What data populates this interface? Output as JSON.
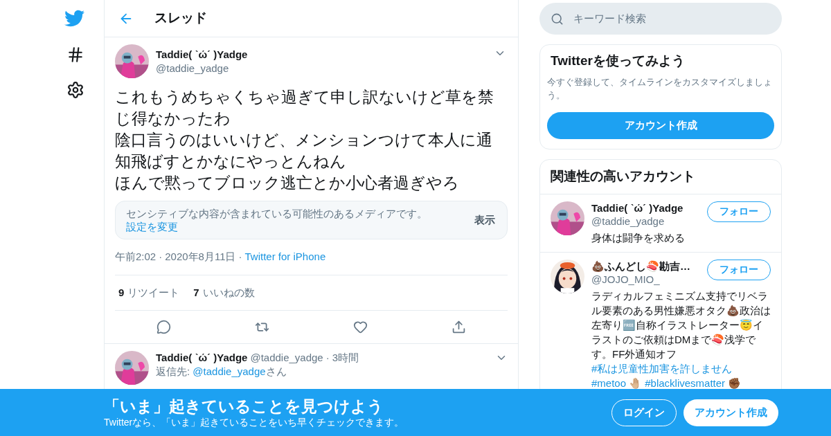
{
  "header": {
    "title": "スレッド"
  },
  "search": {
    "placeholder": "キーワード検索"
  },
  "tweet": {
    "name": "Taddie( ˋώˊ )Yadge",
    "handle": "@taddie_yadge",
    "paragraphs": [
      "これもうめちゃくちゃ過ぎて申し訳ないけど草を禁じ得なかったわ",
      "陰口言うのはいいけど、メンションつけて本人に通知飛ばすとかなにやっとんねん",
      "ほんで黙ってブロック逃亡とか小心者過ぎやろ"
    ],
    "sensitive": {
      "text": "センシティブな内容が含まれている可能性のあるメディアです。",
      "link": "設定を変更",
      "button": "表示"
    },
    "time": "午前2:02",
    "date": "2020年8月11日",
    "source": "Twitter for iPhone",
    "separator": "·",
    "stats": [
      {
        "count": "9",
        "label": "リツイート"
      },
      {
        "count": "7",
        "label": "いいねの数"
      }
    ]
  },
  "reply": {
    "name": "Taddie( ˋώˊ )Yadge",
    "handle": "@taddie_yadge",
    "separator": "·",
    "time": "3時間",
    "reply_prefix": "返信先: ",
    "reply_to": "@taddie_yadge",
    "reply_suffix": "さん"
  },
  "signup_card": {
    "title": "Twitterを使ってみよう",
    "description": "今すぐ登録して、タイムラインをカスタマイズしましょう。",
    "button": "アカウント作成"
  },
  "related": {
    "title": "関連性の高いアカウント",
    "accounts": [
      {
        "name": "Taddie( ˋώˊ )Yadge",
        "handle": "@taddie_yadge",
        "button": "フォロー",
        "bio": [
          {
            "kind": "plain",
            "text": "身体は闘争を求める"
          }
        ]
      },
      {
        "name": "💩ふんどし🍣勘吉…",
        "handle": "@JOJO_MIO_",
        "button": "フォロー",
        "bio": [
          {
            "kind": "plain",
            "text": "ラディカルフェミニズム支持でリベラル要素のある男性嫌悪オタク💩政治は左寄り🆓自称イラストレーター😇イラストのご依頼はDMまで🍣浅学です。FF外通知オフ "
          },
          {
            "kind": "link",
            "text": "#私は児童性加害を許しません"
          },
          {
            "kind": "link",
            "text": "#metoo"
          },
          {
            "kind": "plain",
            "text": "🤚🏼 "
          },
          {
            "kind": "link",
            "text": "#blacklivesmatter"
          },
          {
            "kind": "plain",
            "text": "✊🏾"
          }
        ]
      }
    ]
  },
  "banner": {
    "title": "「いま」起きていることを見つけよう",
    "subtitle": "Twitterなら、「いま」起きていることをいち早くチェックできます。",
    "buttons": [
      {
        "label": "ログイン",
        "kind": "outline"
      },
      {
        "label": "アカウント作成",
        "kind": "filled"
      }
    ]
  }
}
